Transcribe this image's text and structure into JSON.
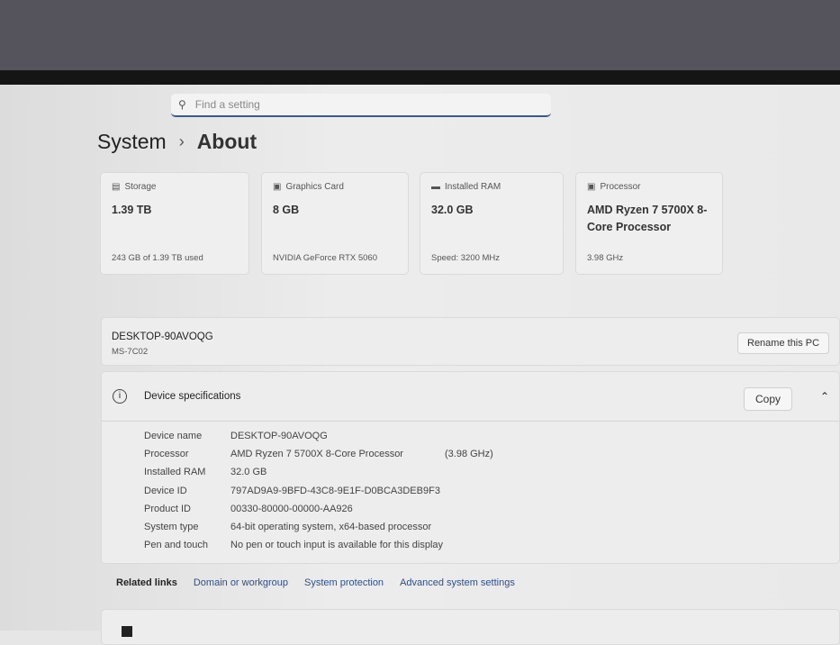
{
  "search": {
    "placeholder": "Find a setting"
  },
  "breadcrumb": {
    "parent": "System",
    "current": "About"
  },
  "cards": [
    {
      "label": "Storage",
      "value": "1.39 TB",
      "sub": "243 GB of 1.39 TB used",
      "icon": "storage-icon"
    },
    {
      "label": "Graphics Card",
      "value": "8 GB",
      "sub": "NVIDIA GeForce RTX 5060",
      "icon": "gpu-icon"
    },
    {
      "label": "Installed RAM",
      "value": "32.0 GB",
      "sub": "Speed: 3200 MHz",
      "icon": "ram-icon"
    },
    {
      "label": "Processor",
      "value": "AMD Ryzen 7 5700X 8-Core Processor",
      "sub": "3.98 GHz",
      "icon": "processor-icon"
    }
  ],
  "pc": {
    "name": "DESKTOP-90AVOQG",
    "model": "MS-7C02",
    "rename": "Rename this PC"
  },
  "specs": {
    "title": "Device specifications",
    "copy": "Copy",
    "rows": [
      {
        "k": "Device name",
        "v": "DESKTOP-90AVOQG"
      },
      {
        "k": "Processor",
        "v": "AMD Ryzen 7 5700X 8-Core Processor",
        "extra": "(3.98 GHz)"
      },
      {
        "k": "Installed RAM",
        "v": "32.0 GB"
      },
      {
        "k": "Device ID",
        "v": "797AD9A9-9BFD-43C8-9E1F-D0BCA3DEB9F3"
      },
      {
        "k": "Product ID",
        "v": "00330-80000-00000-AA926"
      },
      {
        "k": "System type",
        "v": "64-bit operating system, x64-based processor"
      },
      {
        "k": "Pen and touch",
        "v": "No pen or touch input is available for this display"
      }
    ]
  },
  "related": {
    "label": "Related links",
    "links": [
      "Domain or workgroup",
      "System protection",
      "Advanced system settings"
    ]
  }
}
